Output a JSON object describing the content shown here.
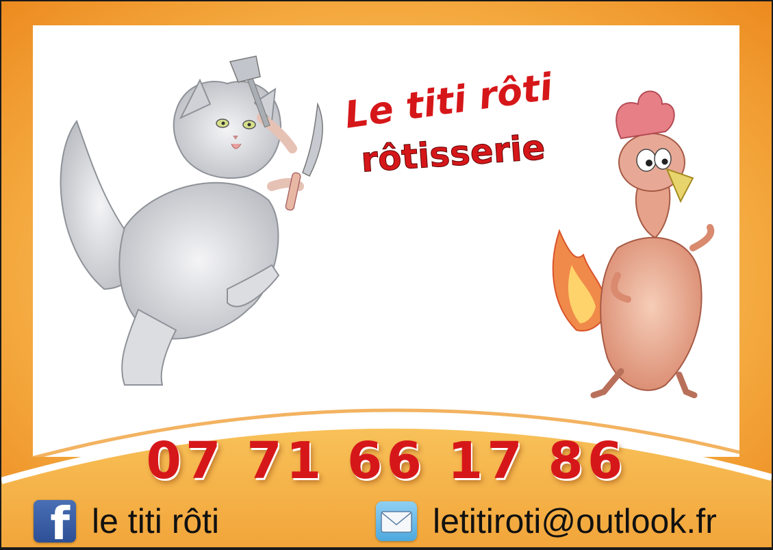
{
  "brand": {
    "name": "Le titi rôti",
    "subtitle": "rôtisserie"
  },
  "contact": {
    "phone": "07 71 66 17 86",
    "facebook_label": "le titi rôti",
    "email": "letitiroti@outlook.fr"
  },
  "icons": {
    "facebook": "facebook-icon",
    "mail": "mail-icon"
  },
  "colors": {
    "accent_red": "#d6171a",
    "orange": "#ec8a1f",
    "facebook_blue": "#3b5998",
    "mail_blue": "#5aaee0"
  }
}
